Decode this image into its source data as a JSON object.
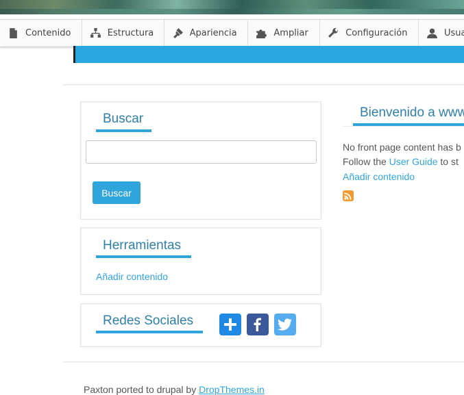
{
  "toolbar": {
    "items": [
      {
        "label": "Contenido",
        "icon": "file-icon"
      },
      {
        "label": "Estructura",
        "icon": "sitemap-icon"
      },
      {
        "label": "Apariencia",
        "icon": "paint-brush-icon"
      },
      {
        "label": "Ampliar",
        "icon": "puzzle-icon"
      },
      {
        "label": "Configuración",
        "icon": "wrench-icon"
      },
      {
        "label": "Usua",
        "icon": "user-icon"
      }
    ]
  },
  "sidebar": {
    "search": {
      "title": "Buscar",
      "value": "",
      "button_label": "Buscar"
    },
    "tools": {
      "title": "Herramientas",
      "link": "Añadir contenido"
    },
    "social": {
      "title": "Redes Sociales",
      "icons": [
        "share-plus-icon",
        "facebook-icon",
        "twitter-icon"
      ]
    }
  },
  "main": {
    "title": "Bienvenido a www",
    "line1": "No front page content has b",
    "line2_prefix": "Follow the ",
    "line2_link": "User Guide",
    "line2_suffix": " to st",
    "add_link": "Añadir contenido",
    "feed_icon": "rss-icon"
  },
  "footer": {
    "text": "Paxton ported to drupal by ",
    "link": "DropThemes.in"
  },
  "colors": {
    "accent": "#2fa5dc",
    "band": "#29a8df",
    "title": "#2f7fa8",
    "facebook": "#3b5998",
    "twitter": "#55acee",
    "share": "#1e88e5"
  }
}
